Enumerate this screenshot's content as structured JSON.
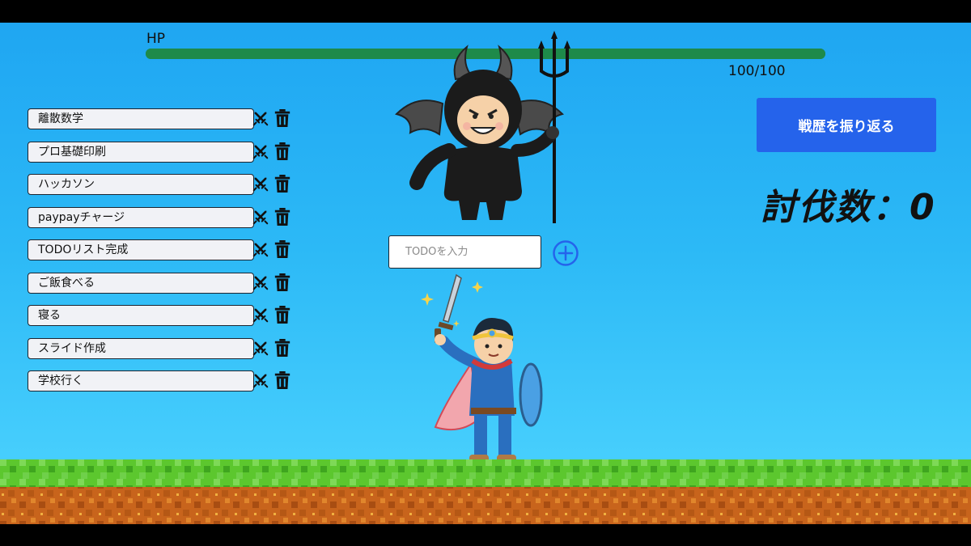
{
  "hp": {
    "label": "HP",
    "current": 100,
    "max": 100,
    "text": "100/100",
    "fraction": 1.0,
    "color": "#1e8a4a"
  },
  "todos": [
    {
      "label": "離散数学"
    },
    {
      "label": "プロ基礎印刷"
    },
    {
      "label": "ハッカソン"
    },
    {
      "label": "paypayチャージ"
    },
    {
      "label": "TODOリスト完成"
    },
    {
      "label": "ご飯食べる"
    },
    {
      "label": "寝る"
    },
    {
      "label": "スライド作成"
    },
    {
      "label": "学校行く"
    }
  ],
  "row_icons": {
    "attack": "crossed-swords-icon",
    "delete": "trash-icon"
  },
  "input": {
    "placeholder": "TODOを入力",
    "value": ""
  },
  "add_icon": "plus-circle-icon",
  "history_button": {
    "label": "戦歴を振り返る",
    "color": "#2563eb"
  },
  "kill_count": {
    "text": "討伐数：0"
  },
  "characters": {
    "enemy": "devil-with-trident",
    "player": "hero-with-sword-and-shield"
  }
}
